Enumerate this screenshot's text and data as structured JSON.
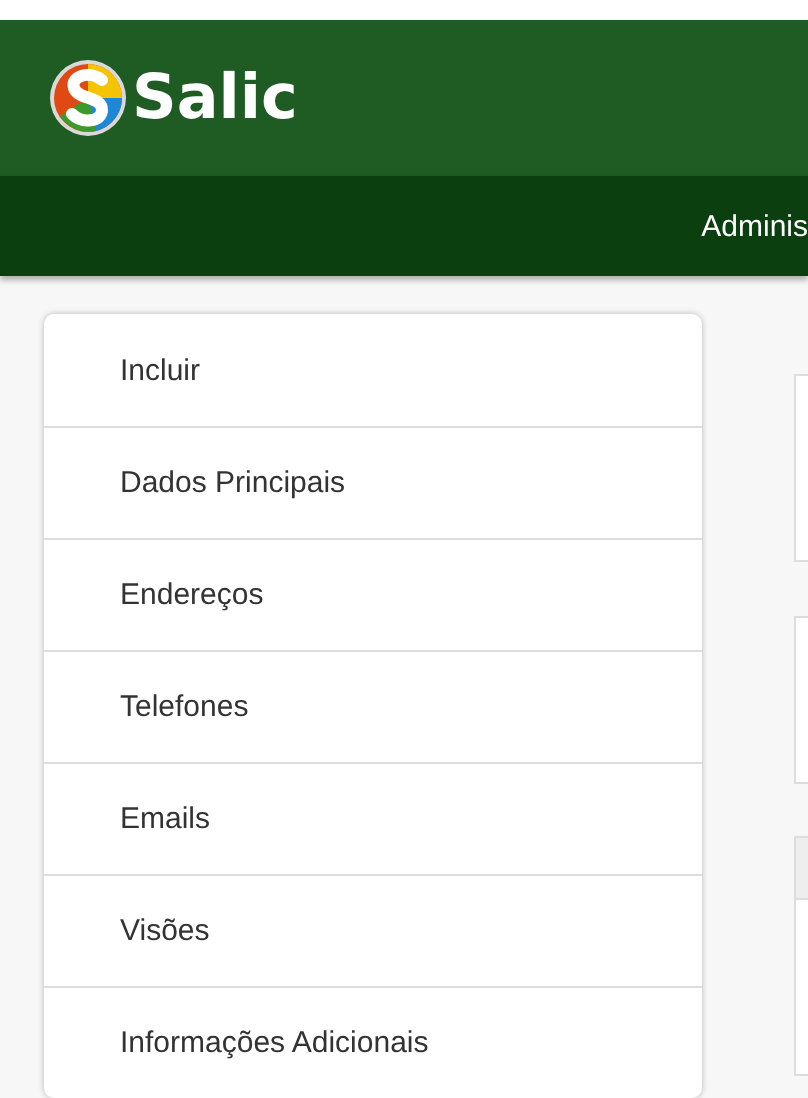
{
  "header": {
    "logo_text": "Salic"
  },
  "nav": {
    "items": [
      "Adminis"
    ]
  },
  "sidebar": {
    "items": [
      {
        "label": "Incluir"
      },
      {
        "label": "Dados Principais"
      },
      {
        "label": "Endereços"
      },
      {
        "label": "Telefones"
      },
      {
        "label": "Emails"
      },
      {
        "label": "Visões"
      },
      {
        "label": "Informações Adicionais"
      }
    ]
  }
}
